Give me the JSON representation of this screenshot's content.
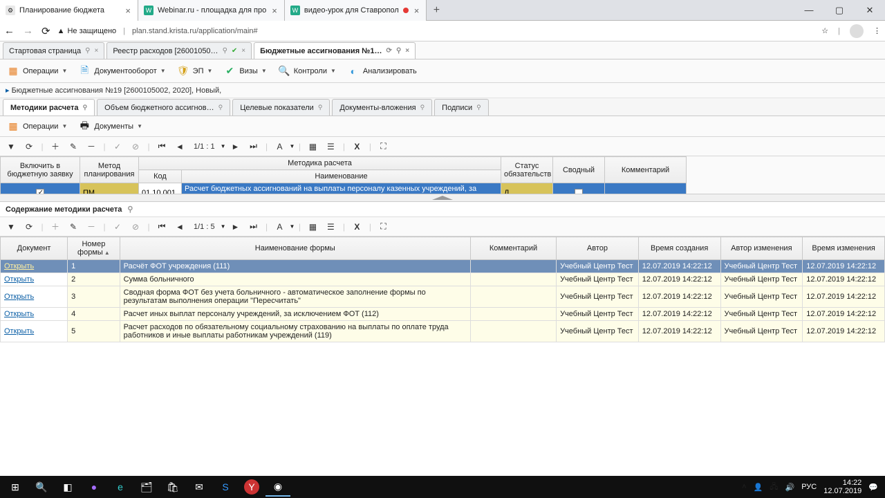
{
  "browser": {
    "tabs": [
      {
        "title": "Планирование бюджета",
        "fav": "⚙",
        "active": true
      },
      {
        "title": "Webinar.ru - площадка для про",
        "fav": "W"
      },
      {
        "title": "видео-урок для Ставропол",
        "fav": "W",
        "rec": true
      }
    ],
    "newtab": "+",
    "security": "Не защищено",
    "url": "plan.stand.krista.ru/application/main#"
  },
  "apptabs": [
    {
      "label": "Стартовая страница"
    },
    {
      "label": "Реестр расходов [26001050…"
    },
    {
      "label": "Бюджетные ассигнования №1…",
      "active": true
    }
  ],
  "toolbar": {
    "ops": "Операции",
    "doc": "Документооборот",
    "ep": "ЭП",
    "vis": "Визы",
    "ctrl": "Контроли",
    "anal": "Анализировать"
  },
  "crumb": "Бюджетные ассигнования №19 [2600105002, 2020], Новый,",
  "subtabs": [
    {
      "l": "Методики расчета",
      "a": true
    },
    {
      "l": "Объем бюджетного ассигнов…"
    },
    {
      "l": "Целевые показатели"
    },
    {
      "l": "Документы-вложения"
    },
    {
      "l": "Подписи"
    }
  ],
  "subtoolbar": {
    "ops": "Операции",
    "docs": "Документы"
  },
  "pager1": "1/1 : 1",
  "grid1": {
    "headers": {
      "inc": "Включить в бюджетную заявку",
      "method": "Метод планирования",
      "code": "Код",
      "name": "Наименование",
      "group": "Методика расчета",
      "status": "Статус обязательств",
      "svod": "Сводный",
      "comm": "Комментарий"
    },
    "row": {
      "inc": true,
      "method": "ПМ",
      "code": "01 10 001",
      "name": "Расчет бюджетных ассигнований на выплаты персоналу казенных учреждений, за исклю",
      "status": "Д",
      "svod": false
    }
  },
  "section2": {
    "title": "Содержание методики расчета",
    "pager": "1/1 : 5",
    "headers": {
      "doc": "Документ",
      "num": "Номер формы",
      "name": "Наименование формы",
      "comm": "Комментарий",
      "author": "Автор",
      "created": "Время создания",
      "chauthor": "Автор изменения",
      "changed": "Время изменения"
    },
    "open": "Открыть",
    "rows": [
      {
        "n": "1",
        "name": "Расчёт ФОТ учреждения (111)",
        "a": "Учебный Центр Тест",
        "c": "12.07.2019 14:22:12",
        "ca": "Учебный Центр Тест",
        "ch": "12.07.2019 14:22:12",
        "sel": true
      },
      {
        "n": "2",
        "name": "Сумма больничного",
        "a": "Учебный Центр Тест",
        "c": "12.07.2019 14:22:12",
        "ca": "Учебный Центр Тест",
        "ch": "12.07.2019 14:22:12"
      },
      {
        "n": "3",
        "name": "Сводная форма ФОТ без учета больничного - автоматическое заполнение формы по результатам выполнения операции \"Пересчитать\"",
        "a": "Учебный Центр Тест",
        "c": "12.07.2019 14:22:12",
        "ca": "Учебный Центр Тест",
        "ch": "12.07.2019 14:22:12"
      },
      {
        "n": "4",
        "name": "Расчет иных выплат персоналу учреждений, за исключением ФОТ (112)",
        "a": "Учебный Центр Тест",
        "c": "12.07.2019 14:22:12",
        "ca": "Учебный Центр Тест",
        "ch": "12.07.2019 14:22:12"
      },
      {
        "n": "5",
        "name": "Расчет расходов по обязательному социальному страхованию на выплаты по оплате труда работников и иные выплаты работникам учреждений (119)",
        "a": "Учебный Центр Тест",
        "c": "12.07.2019 14:22:12",
        "ca": "Учебный Центр Тест",
        "ch": "12.07.2019 14:22:12"
      }
    ]
  },
  "tray": {
    "lang": "РУС",
    "time": "14:22",
    "date": "12.07.2019"
  }
}
